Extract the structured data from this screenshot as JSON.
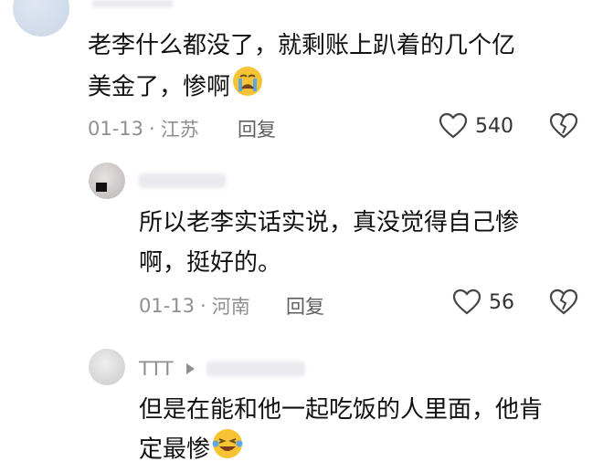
{
  "comments": [
    {
      "text_lines": [
        "老李什么都没了，就剩账上趴着的几个亿",
        "美金了，惨啊"
      ],
      "emoji": "crying-face",
      "date": "01-13",
      "location": "江苏",
      "reply_label": "回复",
      "likes": "540"
    },
    {
      "text_lines": [
        "所以老李实话实说，真没觉得自己惨",
        "啊，挺好的。"
      ],
      "date": "01-13",
      "location": "河南",
      "reply_label": "回复",
      "likes": "56"
    },
    {
      "username": "TTT",
      "text_lines": [
        "但是在能和他一起吃饭的人里面，他肯",
        "定最惨"
      ],
      "emoji": "laughing-tears-face"
    }
  ],
  "colors": {
    "meta": "#8f8f8f",
    "text": "#111111",
    "emoji": "#f5c334"
  }
}
